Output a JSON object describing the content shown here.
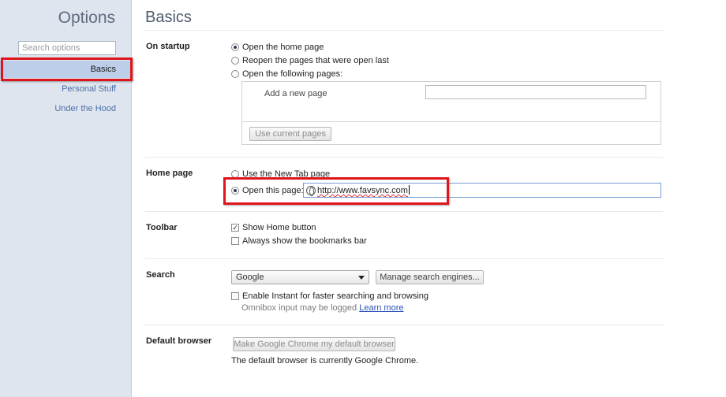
{
  "sidebar": {
    "title": "Options",
    "search_placeholder": "Search options",
    "items": [
      {
        "label": "Basics",
        "selected": true
      },
      {
        "label": "Personal Stuff",
        "selected": false
      },
      {
        "label": "Under the Hood",
        "selected": false
      }
    ]
  },
  "page": {
    "title": "Basics"
  },
  "startup": {
    "label": "On startup",
    "options": [
      {
        "label": "Open the home page",
        "checked": true
      },
      {
        "label": "Reopen the pages that were open last",
        "checked": false
      },
      {
        "label": "Open the following pages:",
        "checked": false
      }
    ],
    "add_page_label": "Add a new page",
    "use_current_button": "Use current pages"
  },
  "home_page": {
    "label": "Home page",
    "options": [
      {
        "label": "Use the New Tab page",
        "checked": false
      },
      {
        "label": "Open this page:",
        "checked": true
      }
    ],
    "url": "http://www.favsync.com"
  },
  "toolbar": {
    "label": "Toolbar",
    "options": [
      {
        "label": "Show Home button",
        "checked": true
      },
      {
        "label": "Always show the bookmarks bar",
        "checked": false
      }
    ]
  },
  "search": {
    "label": "Search",
    "engine": "Google",
    "manage_button": "Manage search engines...",
    "instant_label": "Enable Instant for faster searching and browsing",
    "instant_checked": false,
    "omnibox_note": "Omnibox input may be logged",
    "learn_more": "Learn more"
  },
  "default_browser": {
    "label": "Default browser",
    "button": "Make Google Chrome my default browser",
    "status": "The default browser is currently Google Chrome."
  },
  "colors": {
    "highlight": "#e0141b",
    "sidebar_bg": "#dfe5ee",
    "selected_nav_bg": "#bccee8",
    "link": "#2850b8"
  }
}
